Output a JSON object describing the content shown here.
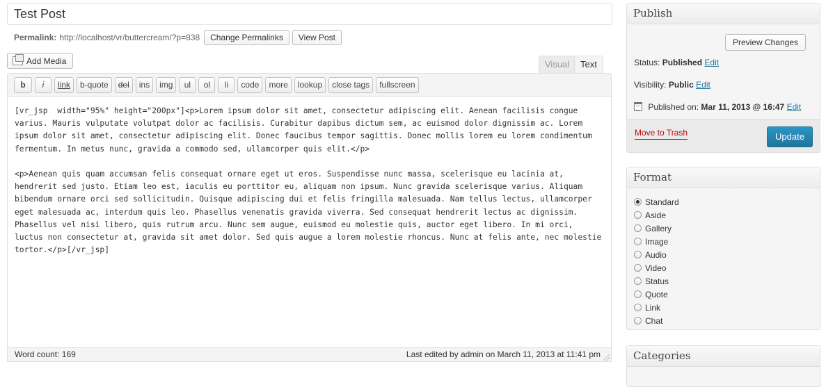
{
  "post": {
    "title": "Test Post",
    "permalink_label": "Permalink:",
    "permalink_url": "http://localhost/vr/buttercream/?p=838",
    "change_permalinks": "Change Permalinks",
    "view_post": "View Post"
  },
  "editor": {
    "add_media": "Add Media",
    "tabs": {
      "visual": "Visual",
      "text": "Text"
    },
    "toolbar": [
      "b",
      "i",
      "link",
      "b-quote",
      "del",
      "ins",
      "img",
      "ul",
      "ol",
      "li",
      "code",
      "more",
      "lookup",
      "close tags",
      "fullscreen"
    ],
    "content": "[vr_jsp  width=\"95%\" height=\"200px\"]<p>Lorem ipsum dolor sit amet, consectetur adipiscing elit. Aenean facilisis congue varius. Mauris vulputate volutpat dolor ac facilisis. Curabitur dapibus dictum sem, ac euismod dolor dignissim ac. Lorem ipsum dolor sit amet, consectetur adipiscing elit. Donec faucibus tempor sagittis. Donec mollis lorem eu lorem condimentum fermentum. In metus nunc, gravida a commodo sed, ullamcorper quis elit.</p>\n\n<p>Aenean quis quam accumsan felis consequat ornare eget ut eros. Suspendisse nunc massa, scelerisque eu lacinia at, hendrerit sed justo. Etiam leo est, iaculis eu porttitor eu, aliquam non ipsum. Nunc gravida scelerisque varius. Aliquam bibendum ornare orci sed sollicitudin. Quisque adipiscing dui et felis fringilla malesuada. Nam tellus lectus, ullamcorper eget malesuada ac, interdum quis leo. Phasellus venenatis gravida viverra. Sed consequat hendrerit lectus ac dignissim. Phasellus vel nisi libero, quis rutrum arcu. Nunc sem augue, euismod eu molestie quis, auctor eget libero. In mi orci, luctus non consectetur at, gravida sit amet dolor. Sed quis augue a lorem molestie rhoncus. Nunc at felis ante, nec molestie tortor.</p>[/vr_jsp]",
    "word_count": "Word count: 169",
    "last_edited": "Last edited by admin on March 11, 2013 at 11:41 pm"
  },
  "publish": {
    "title": "Publish",
    "preview": "Preview Changes",
    "status_label": "Status:",
    "status_value": "Published",
    "visibility_label": "Visibility:",
    "visibility_value": "Public",
    "published_on_label": "Published on:",
    "published_on_value": "Mar 11, 2013 @ 16:47",
    "edit": "Edit",
    "trash": "Move to Trash",
    "update": "Update"
  },
  "format": {
    "title": "Format",
    "selected": "Standard",
    "options": [
      "Standard",
      "Aside",
      "Gallery",
      "Image",
      "Audio",
      "Video",
      "Status",
      "Quote",
      "Link",
      "Chat"
    ]
  },
  "categories": {
    "title": "Categories"
  },
  "colors": {
    "link": "#21759b",
    "trash": "#bc0b0b",
    "primary_button": "#21759b"
  }
}
